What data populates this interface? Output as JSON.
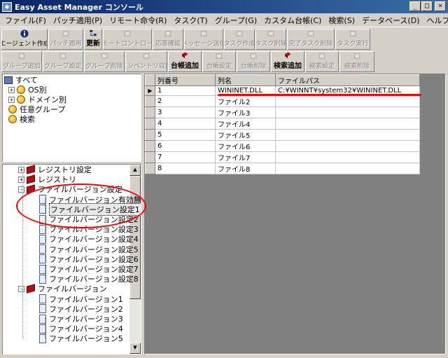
{
  "window": {
    "title": "Easy Asset Manager コンソール",
    "controls": {
      "minimize": "_",
      "maximize": "□",
      "close": "×"
    }
  },
  "menu": [
    "ファイル(F)",
    "パッチ適用(P)",
    "リモート命令(R)",
    "タスク(T)",
    "グループ(G)",
    "カスタム台帳(C)",
    "検索(S)",
    "データベース(D)",
    "ヘルプ(H)"
  ],
  "toolbar1": [
    {
      "label": "エージェント作成",
      "icon": "info-icon",
      "enabled": true,
      "width": 66
    },
    {
      "label": "パッチ適用",
      "icon": "patch-icon",
      "enabled": false,
      "width": 50
    },
    {
      "label": "更新",
      "icon": "refresh-icon",
      "enabled": true,
      "width": 26
    },
    {
      "label": "リモートコントロール",
      "icon": "remote-icon",
      "enabled": false,
      "width": 70
    },
    {
      "label": "応答確認",
      "icon": "response-icon",
      "enabled": false,
      "width": 44
    },
    {
      "label": "メッセージ送信",
      "icon": "message-icon",
      "enabled": false,
      "width": 56
    },
    {
      "label": "タスク作成",
      "icon": "task-create-icon",
      "enabled": false,
      "width": 44
    },
    {
      "label": "タスク削除",
      "icon": "task-delete-icon",
      "enabled": false,
      "width": 44
    },
    {
      "label": "完了タスク削除",
      "icon": "done-task-delete-icon",
      "enabled": false,
      "width": 68
    },
    {
      "label": "タスク実行",
      "icon": "task-run-icon",
      "enabled": false,
      "width": 50
    }
  ],
  "toolbar2": [
    {
      "label": "グループ追加",
      "icon": "group-add-icon",
      "enabled": false,
      "width": 58
    },
    {
      "label": "グループ設定",
      "icon": "group-settings-icon",
      "enabled": false,
      "width": 58
    },
    {
      "label": "グループ削除",
      "icon": "group-delete-icon",
      "enabled": false,
      "width": 58
    },
    {
      "label": "インベントリ収集",
      "icon": "inventory-icon",
      "enabled": false,
      "width": 60
    },
    {
      "label": "台帳追加",
      "icon": "ledger-add-icon",
      "enabled": true,
      "width": 48
    },
    {
      "label": "台帳設定",
      "icon": "ledger-settings-icon",
      "enabled": false,
      "width": 48
    },
    {
      "label": "台帳削除",
      "icon": "ledger-delete-icon",
      "enabled": false,
      "width": 48
    },
    {
      "label": "検索追加",
      "icon": "search-add-icon",
      "enabled": true,
      "width": 48
    },
    {
      "label": "検索設定",
      "icon": "search-settings-icon",
      "enabled": false,
      "width": 48
    },
    {
      "label": "検索削除",
      "icon": "search-delete-icon",
      "enabled": false,
      "width": 50
    }
  ],
  "tree_top": [
    {
      "label": "すべて",
      "level": 0,
      "icon": "computer",
      "expander": ""
    },
    {
      "label": "OS別",
      "level": 1,
      "icon": "globe",
      "expander": "+"
    },
    {
      "label": "ドメイン別",
      "level": 1,
      "icon": "globe",
      "expander": "+"
    },
    {
      "label": "任意グループ",
      "level": 1,
      "icon": "globe",
      "expander": ""
    },
    {
      "label": "検索",
      "level": 1,
      "icon": "globe",
      "expander": ""
    }
  ],
  "tree_bottom": [
    {
      "label": "レジストリ設定",
      "level": 0,
      "icon": "book",
      "expander": "+"
    },
    {
      "label": "レジストリ",
      "level": 0,
      "icon": "book",
      "expander": "+"
    },
    {
      "label": "ファイルバージョン設定",
      "level": 0,
      "icon": "book",
      "expander": "-"
    },
    {
      "label": "ファイルバージョン有効無効",
      "level": 1,
      "icon": "page",
      "expander": ""
    },
    {
      "label": "ファイルバージョン設定1",
      "level": 1,
      "icon": "page",
      "expander": "",
      "selected": true
    },
    {
      "label": "ファイルバージョン設定2",
      "level": 1,
      "icon": "page",
      "expander": ""
    },
    {
      "label": "ファイルバージョン設定3",
      "level": 1,
      "icon": "page",
      "expander": ""
    },
    {
      "label": "ファイルバージョン設定4",
      "level": 1,
      "icon": "page",
      "expander": ""
    },
    {
      "label": "ファイルバージョン設定5",
      "level": 1,
      "icon": "page",
      "expander": ""
    },
    {
      "label": "ファイルバージョン設定6",
      "level": 1,
      "icon": "page",
      "expander": ""
    },
    {
      "label": "ファイルバージョン設定7",
      "level": 1,
      "icon": "page",
      "expander": ""
    },
    {
      "label": "ファイルバージョン設定8",
      "level": 1,
      "icon": "page",
      "expander": ""
    },
    {
      "label": "ファイルバージョン",
      "level": 0,
      "icon": "book",
      "expander": "-"
    },
    {
      "label": "ファイルバージョン1",
      "level": 1,
      "icon": "page",
      "expander": ""
    },
    {
      "label": "ファイルバージョン2",
      "level": 1,
      "icon": "page",
      "expander": ""
    },
    {
      "label": "ファイルバージョン3",
      "level": 1,
      "icon": "page",
      "expander": ""
    },
    {
      "label": "ファイルバージョン4",
      "level": 1,
      "icon": "page",
      "expander": ""
    },
    {
      "label": "ファイルバージョン5",
      "level": 1,
      "icon": "page",
      "expander": ""
    }
  ],
  "grid": {
    "columns": [
      "列番号",
      "列名",
      "ファイルパス"
    ],
    "current_row_marker": "▶",
    "rows": [
      [
        "1",
        "WININET.DLL",
        "C:¥WINNT¥system32¥WININET.DLL"
      ],
      [
        "2",
        "ファイル2",
        ""
      ],
      [
        "3",
        "ファイル3",
        ""
      ],
      [
        "4",
        "ファイル4",
        ""
      ],
      [
        "5",
        "ファイル5",
        ""
      ],
      [
        "6",
        "ファイル6",
        ""
      ],
      [
        "7",
        "ファイル7",
        ""
      ],
      [
        "8",
        "ファイル8",
        ""
      ]
    ]
  },
  "colors": {
    "annotation": "#ff0000",
    "titlebar": "#0a246a",
    "face": "#d4d0c8"
  }
}
